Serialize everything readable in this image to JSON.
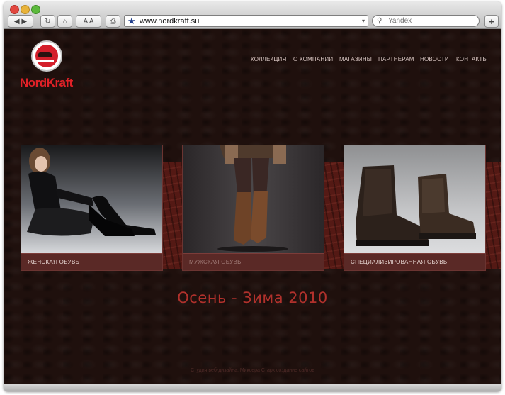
{
  "browser": {
    "address": "www.nordkraft.su",
    "search_placeholder": "Yandex",
    "back_forward_label": "◀ ▶",
    "reload_label": "↻",
    "home_label": "⌂",
    "font_size_label": "A A",
    "print_label": "⎙",
    "new_tab_label": "+",
    "bookmark_star": "★",
    "address_dropdown": "▾",
    "search_glyph": "⚲"
  },
  "site": {
    "logo_text": "NordKraft",
    "menu": [
      "КОЛЛЕКЦИЯ",
      "О КОМПАНИИ",
      "МАГАЗИНЫ",
      "ПАРТНЕРАМ",
      "НОВОСТИ",
      "КОНТАКТЫ"
    ],
    "categories": [
      "ЖЕНСКАЯ ОБУВЬ",
      "МУЖСКАЯ ОБУВЬ",
      "СПЕЦИАЛИЗИРОВАННАЯ ОБУВЬ"
    ],
    "season": "Осень - Зима 2010",
    "footer": "Студия веб-дизайна: Миксера Старк создание сайтов"
  },
  "colors": {
    "background": "#1f100d",
    "accent": "#b1312c",
    "logo_red": "#e02127",
    "caption_bg": "#5a2926"
  }
}
